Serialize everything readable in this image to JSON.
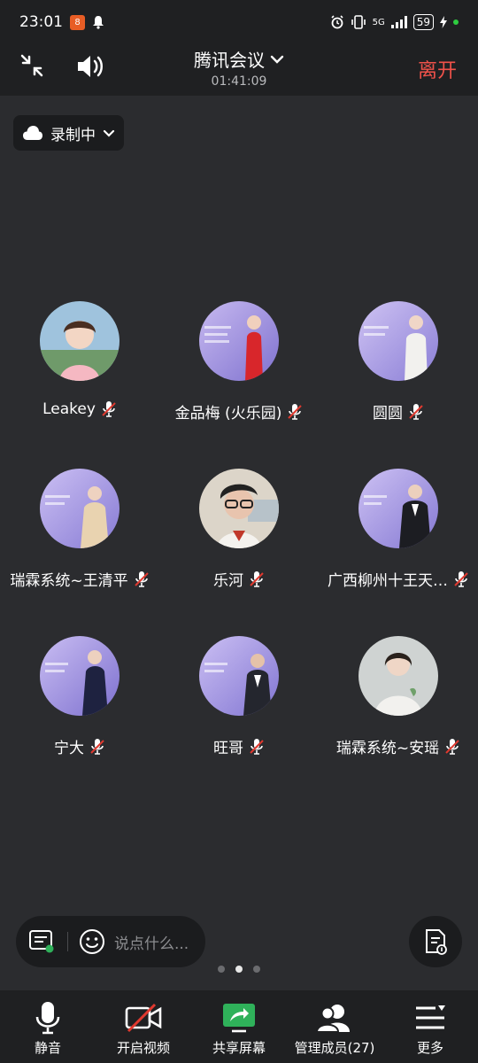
{
  "status_bar": {
    "time": "23:01",
    "app_badge": "8",
    "network": "5G",
    "battery": "59"
  },
  "header": {
    "title": "腾讯会议",
    "elapsed": "01:41:09",
    "leave_label": "离开"
  },
  "recording": {
    "label": "录制中"
  },
  "participants": [
    {
      "name": "Leakey",
      "avatar_color": "#b9d4e8"
    },
    {
      "name": "金品梅 (火乐园)",
      "avatar_color": "#9b8fd6"
    },
    {
      "name": "圆圆",
      "avatar_color": "#a99be0"
    },
    {
      "name": "瑞霖系统~王清平",
      "avatar_color": "#9d94dc"
    },
    {
      "name": "乐河",
      "avatar_color": "#d9c9b2"
    },
    {
      "name": "广西柳州十王天…",
      "avatar_color": "#a89de2"
    },
    {
      "name": "宁大",
      "avatar_color": "#958be0"
    },
    {
      "name": "旺哥",
      "avatar_color": "#a598de"
    },
    {
      "name": "瑞霖系统~安瑶",
      "avatar_color": "#cfd4d3"
    }
  ],
  "chat": {
    "placeholder": "说点什么..."
  },
  "pager": {
    "pages": 3,
    "active": 2
  },
  "toolbar": {
    "mute_label": "静音",
    "video_label": "开启视频",
    "share_label": "共享屏幕",
    "members_label": "管理成员(27)",
    "more_label": "更多"
  },
  "colors": {
    "background": "#2b2c2f",
    "bar": "#1f2022",
    "leave": "#f0524a",
    "share_green": "#2fb15a",
    "mute_red": "#e0392f"
  }
}
